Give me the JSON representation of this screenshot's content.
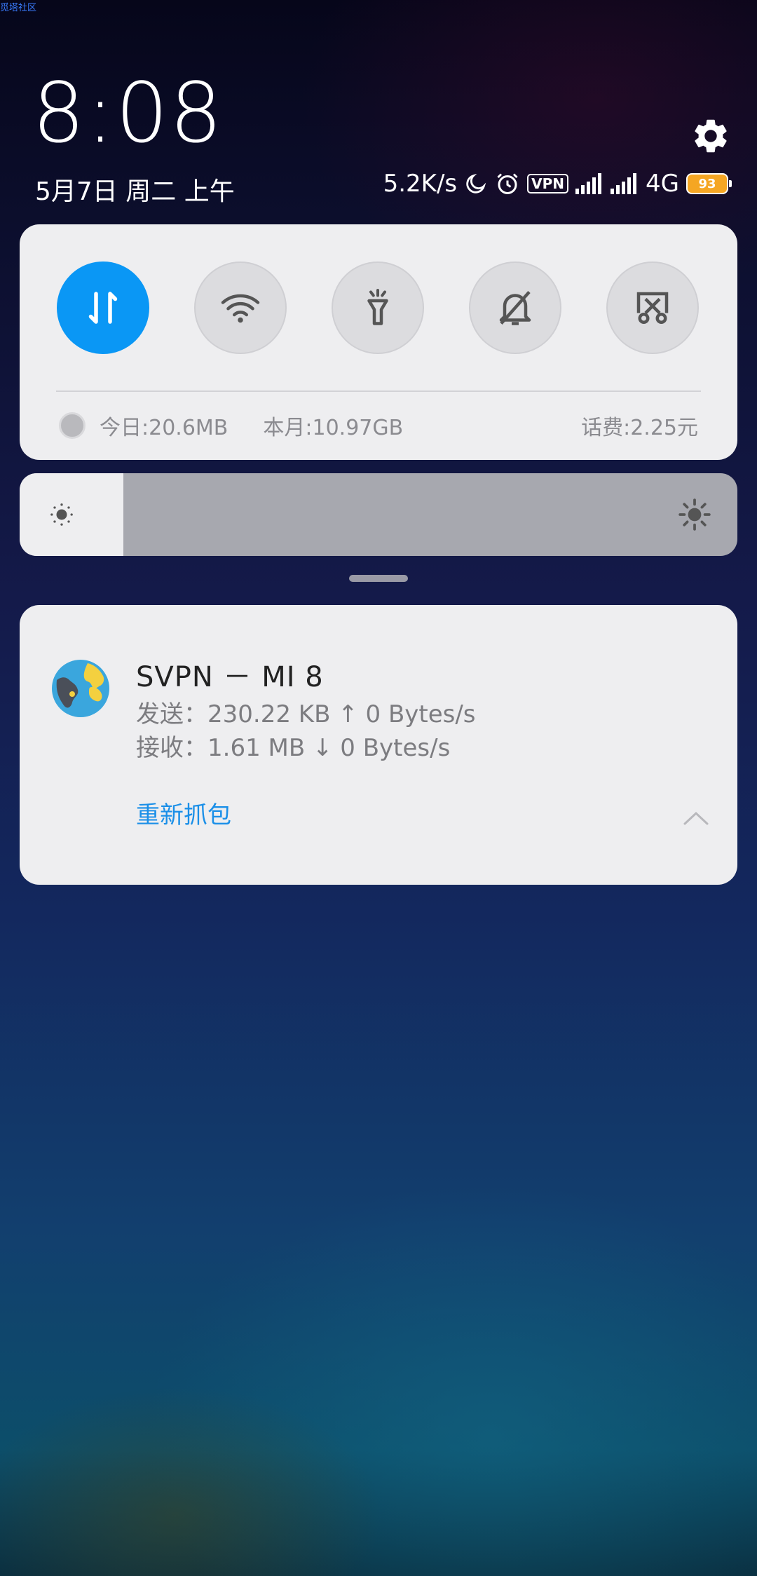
{
  "watermark": "觅塔社区",
  "clock": {
    "time": "8:08",
    "date": "5月7日 周二 上午"
  },
  "status_bar": {
    "net_speed": "5.2K/s",
    "vpn_label": "VPN",
    "network_type": "4G",
    "battery_level": "93",
    "icons": [
      "moon-icon",
      "alarm-icon",
      "vpn-icon",
      "signal-icon",
      "signal-icon",
      "battery-icon"
    ]
  },
  "quick_settings": {
    "toggles": [
      {
        "name": "mobile-data",
        "icon": "data-arrows-icon",
        "on": true
      },
      {
        "name": "wifi",
        "icon": "wifi-icon",
        "on": false
      },
      {
        "name": "flashlight",
        "icon": "flashlight-icon",
        "on": false
      },
      {
        "name": "silent",
        "icon": "bell-off-icon",
        "on": false
      },
      {
        "name": "screenshot",
        "icon": "screenshot-icon",
        "on": false
      }
    ],
    "usage": {
      "today": "今日:20.6MB",
      "month": "本月:10.97GB",
      "fee": "话费:2.25元"
    }
  },
  "brightness": {
    "level": 0.145
  },
  "notification": {
    "app_icon": "globe-icon",
    "title": "SVPN － MI 8",
    "send": "发送：230.22 KB ↑ 0 Bytes/s",
    "receive": "接收：1.61 MB ↓ 0 Bytes/s",
    "action": "重新抓包"
  },
  "colors": {
    "accent": "#0a97f5",
    "action_text": "#1a8fe8",
    "battery": "#f5a623"
  }
}
